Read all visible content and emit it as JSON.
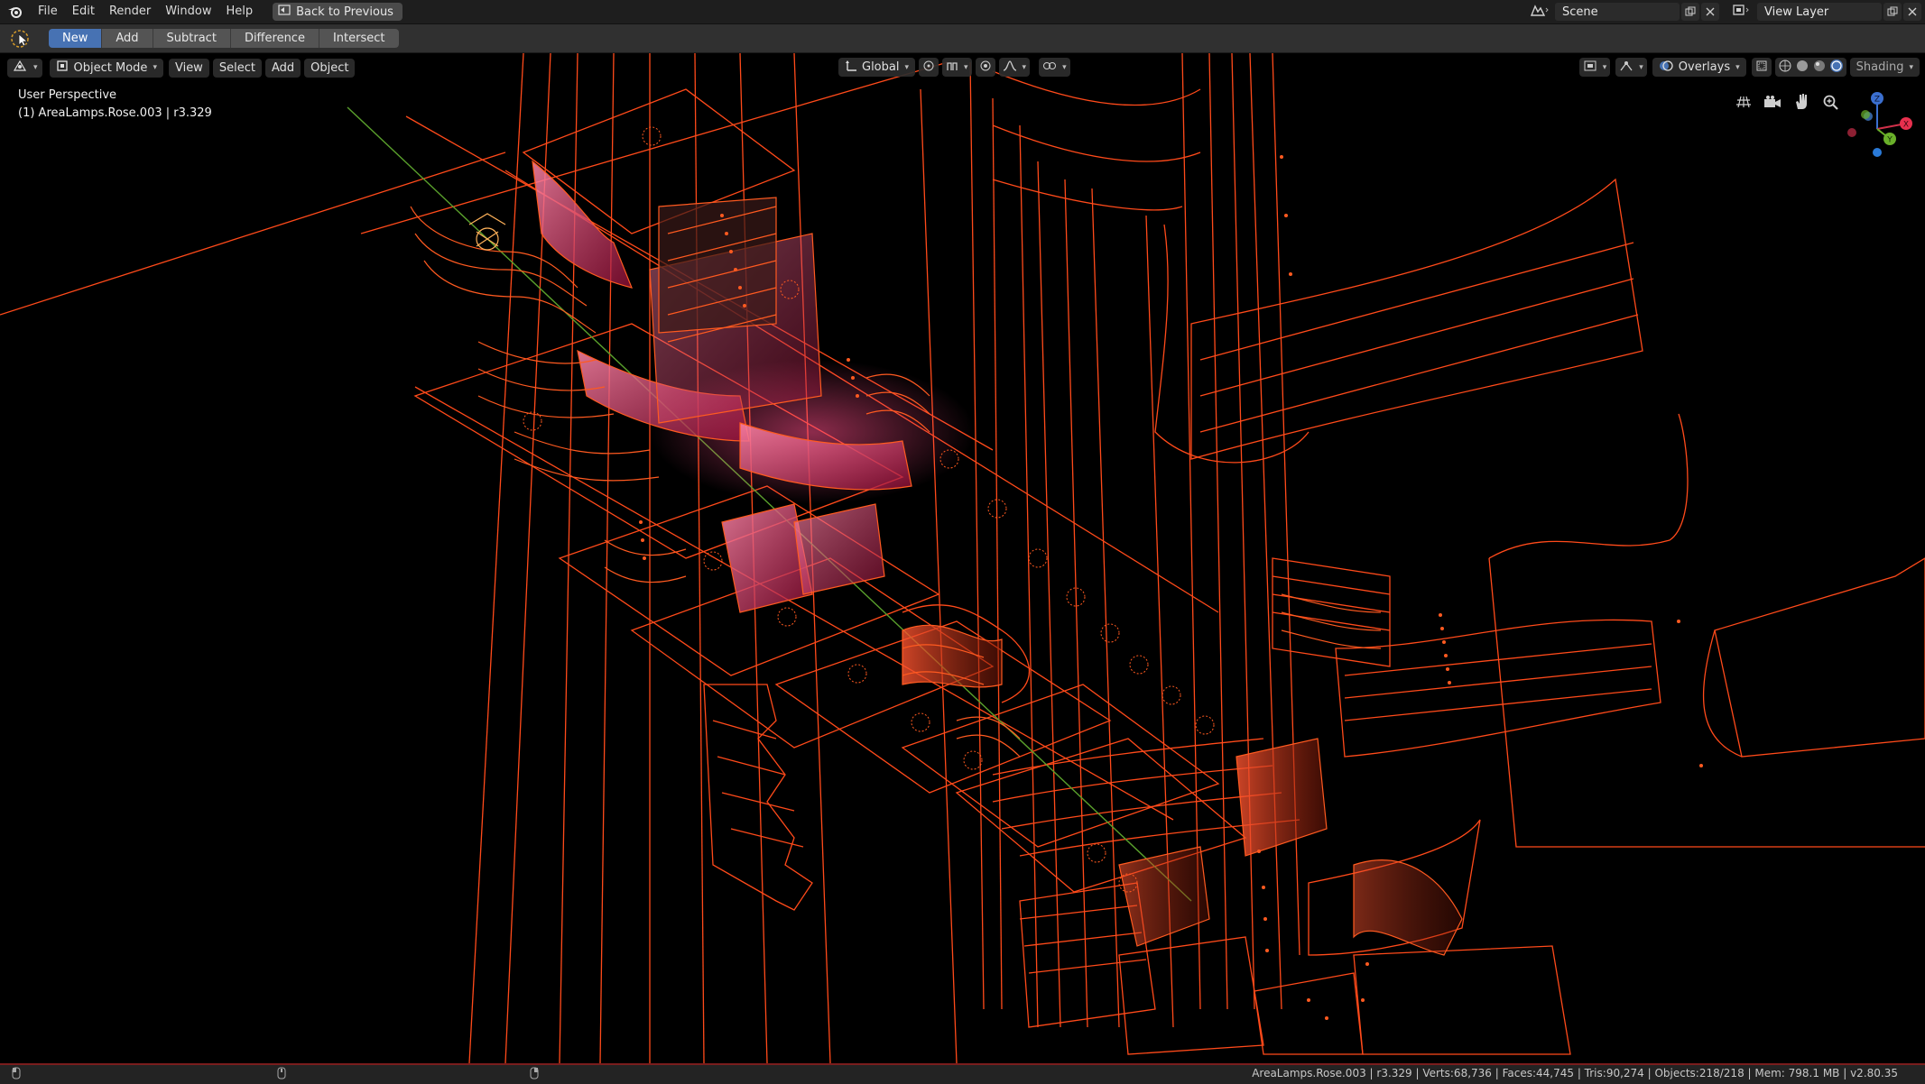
{
  "topbar": {
    "menu": [
      "File",
      "Edit",
      "Render",
      "Window",
      "Help"
    ],
    "back_button": "Back to Previous",
    "scene_label": "Scene",
    "view_layer_label": "View Layer"
  },
  "tool_header": {
    "buttons": [
      "New",
      "Add",
      "Subtract",
      "Difference",
      "Intersect"
    ],
    "active": "New"
  },
  "viewport_header": {
    "mode": "Object Mode",
    "menus": [
      "View",
      "Select",
      "Add",
      "Object"
    ],
    "transform_orientation": "Global",
    "overlays": "Overlays",
    "shading": "Shading"
  },
  "viewport": {
    "perspective": "User Perspective",
    "active_object": "(1) AreaLamps.Rose.003 | r3.329",
    "gizmo_axes": [
      "X",
      "Y",
      "Z"
    ],
    "colors": {
      "wire": "#ff4a1a",
      "accent": "#4772b3",
      "mesh": "#ff3d77",
      "y_axis": "#5aa02c"
    }
  },
  "statusbar": {
    "stats": "AreaLamps.Rose.003 | r3.329 | Verts:68,736 | Faces:44,745 | Tris:90,274 | Objects:218/218 | Mem: 798.1 MB | v2.80.35"
  },
  "icons": [
    "blender-logo-icon",
    "cursor-select-icon",
    "editor-type-icon",
    "object-mode-icon",
    "transform-icon",
    "snap-icon",
    "proportional-icon",
    "camera-icon",
    "grid-icon",
    "hand-icon",
    "zoom-icon",
    "mouse-icon"
  ]
}
